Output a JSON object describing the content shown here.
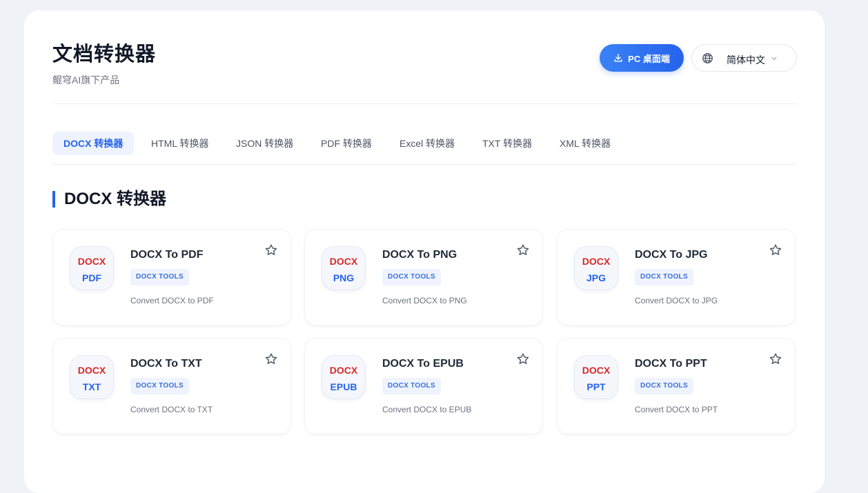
{
  "header": {
    "title": "文档转换器",
    "subtitle": "鲲穹AI旗下产品",
    "pc_button_label": "PC 桌面端",
    "language_label": "简体中文"
  },
  "tabs": [
    {
      "label": "DOCX 转换器",
      "active": true
    },
    {
      "label": "HTML 转换器",
      "active": false
    },
    {
      "label": "JSON 转换器",
      "active": false
    },
    {
      "label": "PDF 转换器",
      "active": false
    },
    {
      "label": "Excel 转换器",
      "active": false
    },
    {
      "label": "TXT 转换器",
      "active": false
    },
    {
      "label": "XML 转换器",
      "active": false
    }
  ],
  "section": {
    "title": "DOCX 转换器"
  },
  "cards": [
    {
      "from": "DOCX",
      "to": "PDF",
      "title": "DOCX To PDF",
      "tag": "DOCX TOOLS",
      "desc": "Convert DOCX to PDF"
    },
    {
      "from": "DOCX",
      "to": "PNG",
      "title": "DOCX To PNG",
      "tag": "DOCX TOOLS",
      "desc": "Convert DOCX to PNG"
    },
    {
      "from": "DOCX",
      "to": "JPG",
      "title": "DOCX To JPG",
      "tag": "DOCX TOOLS",
      "desc": "Convert DOCX to JPG"
    },
    {
      "from": "DOCX",
      "to": "TXT",
      "title": "DOCX To TXT",
      "tag": "DOCX TOOLS",
      "desc": "Convert DOCX to TXT"
    },
    {
      "from": "DOCX",
      "to": "EPUB",
      "title": "DOCX To EPUB",
      "tag": "DOCX TOOLS",
      "desc": "Convert DOCX to EPUB"
    },
    {
      "from": "DOCX",
      "to": "PPT",
      "title": "DOCX To PPT",
      "tag": "DOCX TOOLS",
      "desc": "Convert DOCX to PPT"
    }
  ],
  "icons": {
    "pc_button": "download-icon",
    "language": "globe-icon",
    "language_dropdown": "chevron-down-icon",
    "favorite": "star-icon"
  },
  "colors": {
    "accent": "#2563eb",
    "badge_from": "#dc2626",
    "background": "#eff2f7"
  }
}
